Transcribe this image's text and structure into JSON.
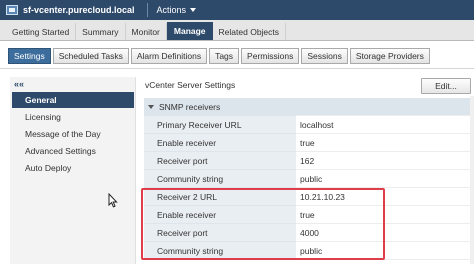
{
  "titlebar": {
    "title": "sf-vcenter.purecloud.local",
    "actions": "Actions"
  },
  "top_tabs": [
    {
      "label": "Getting Started"
    },
    {
      "label": "Summary"
    },
    {
      "label": "Monitor"
    },
    {
      "label": "Manage"
    },
    {
      "label": "Related Objects"
    }
  ],
  "sub_tabs": [
    {
      "label": "Settings"
    },
    {
      "label": "Scheduled Tasks"
    },
    {
      "label": "Alarm Definitions"
    },
    {
      "label": "Tags"
    },
    {
      "label": "Permissions"
    },
    {
      "label": "Sessions"
    },
    {
      "label": "Storage Providers"
    }
  ],
  "leftnav": {
    "collapse": "««",
    "items": [
      {
        "label": "General"
      },
      {
        "label": "Licensing"
      },
      {
        "label": "Message of the Day"
      },
      {
        "label": "Advanced Settings"
      },
      {
        "label": "Auto Deploy"
      }
    ]
  },
  "main": {
    "section_title": "vCenter Server Settings",
    "edit_label": "Edit...",
    "group_label": "SNMP receivers",
    "rows": [
      {
        "key": "Primary Receiver URL",
        "value": "localhost"
      },
      {
        "key": "Enable receiver",
        "value": "true"
      },
      {
        "key": "Receiver port",
        "value": "162"
      },
      {
        "key": "Community string",
        "value": "public"
      },
      {
        "key": "Receiver 2 URL",
        "value": "10.21.10.23"
      },
      {
        "key": "Enable receiver",
        "value": "true"
      },
      {
        "key": "Receiver port",
        "value": "4000"
      },
      {
        "key": "Community string",
        "value": "public"
      }
    ]
  },
  "colors": {
    "header_navy": "#2e4a6b",
    "subtab_active": "#3d6d9c",
    "highlight_red": "#e03d4b"
  }
}
